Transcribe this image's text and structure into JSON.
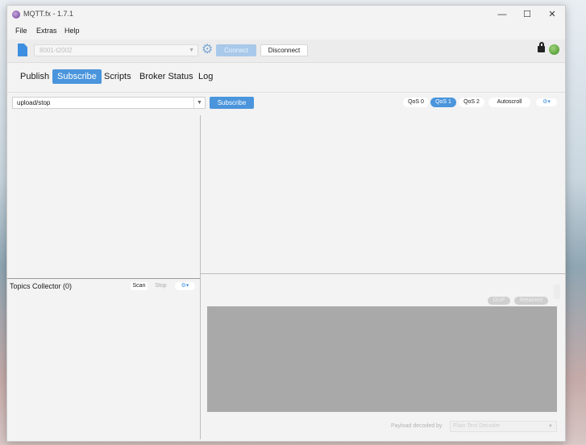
{
  "window": {
    "title": "MQTT.fx - 1.7.1",
    "controls": {
      "minimize": "—",
      "maximize": "☐",
      "close": "✕"
    }
  },
  "menu": [
    "File",
    "Extras",
    "Help"
  ],
  "toolbar": {
    "profile": "8001-t2002",
    "connect_label": "Connect",
    "disconnect_label": "Disconnect",
    "connected": true,
    "status_color": "#4caf2c"
  },
  "tabs": [
    {
      "label": "Publish",
      "active": false
    },
    {
      "label": "Subscribe",
      "active": true
    },
    {
      "label": "Scripts",
      "active": false
    },
    {
      "label": "Broker Status",
      "active": false
    },
    {
      "label": "Log",
      "active": false
    }
  ],
  "subscribe": {
    "topic_value": "upload/stop",
    "subscribe_label": "Subscribe",
    "qos_options": [
      {
        "label": "QoS 0",
        "active": false
      },
      {
        "label": "QoS 1",
        "active": true
      },
      {
        "label": "QoS 2",
        "active": false
      }
    ],
    "autoscroll_label": "Autoscroll",
    "settings_glyph": "⚙▾"
  },
  "topics_collector": {
    "label": "Topics Collector (0)",
    "scan_label": "Scan",
    "stop_label": "Stop",
    "settings_glyph": "⚙▾"
  },
  "message_detail": {
    "topic_placeholder": "",
    "dup_label": "DUP",
    "retained_label": "Retained",
    "payload_label": "Payload decoded by",
    "decoder_value": "Plain Text Decoder"
  },
  "colors": {
    "accent": "#4a95dc",
    "payload_bg": "#a9a9a9"
  }
}
